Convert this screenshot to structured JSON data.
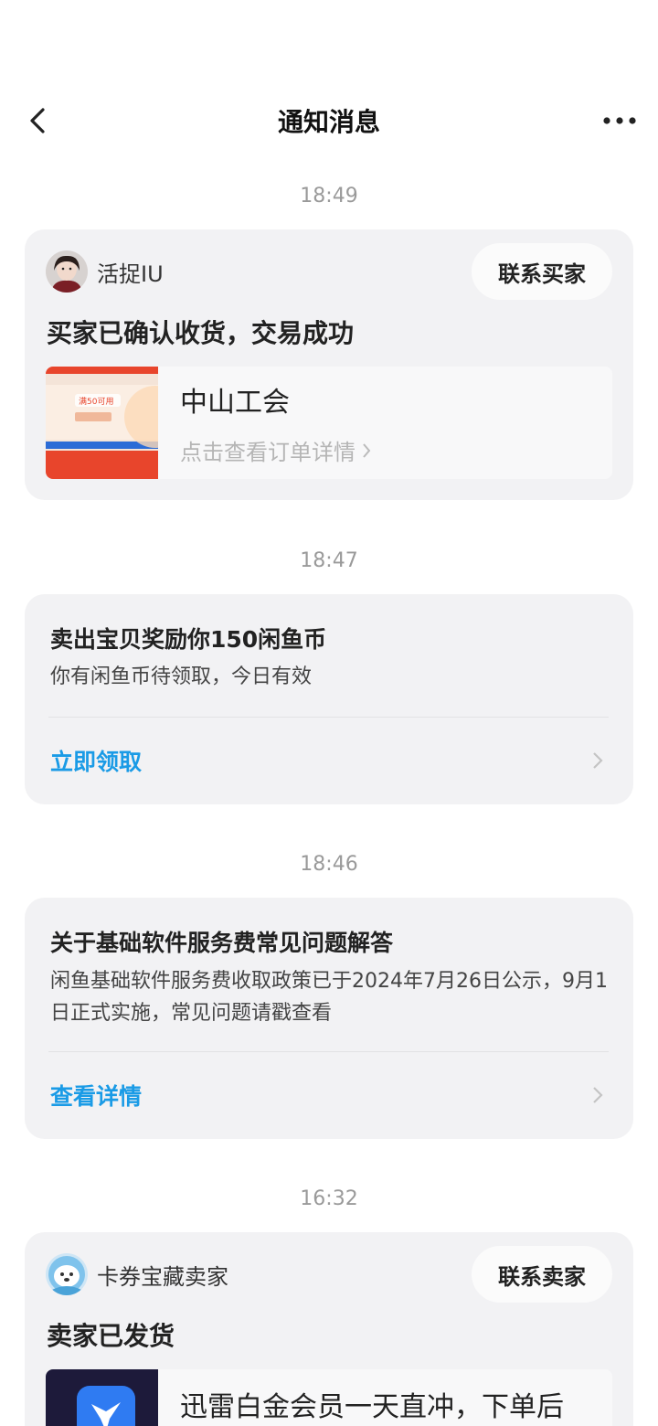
{
  "header": {
    "title": "通知消息"
  },
  "messages": [
    {
      "time": "18:49",
      "user": "活捉IU",
      "contact_label": "联系买家",
      "status": "买家已确认收货，交易成功",
      "product": {
        "name": "中山工会",
        "link": "点击查看订单详情",
        "thumb_text": "满50可用"
      }
    },
    {
      "time": "18:47",
      "title": "卖出宝贝奖励你150闲鱼币",
      "subtitle": "你有闲鱼币待领取，今日有效",
      "action": "立即领取"
    },
    {
      "time": "18:46",
      "title": "关于基础软件服务费常见问题解答",
      "subtitle": "闲鱼基础软件服务费收取政策已于2024年7月26日公示，9月1日正式实施，常见问题请戳查看",
      "action": "查看详情"
    },
    {
      "time": "16:32",
      "user": "卡券宝藏卖家",
      "contact_label": "联系卖家",
      "status": "卖家已发货",
      "product": {
        "name": "迅雷白金会员一天直冲，下单后"
      }
    }
  ],
  "colors": {
    "accent": "#1a9be6",
    "card_bg": "#f2f2f4",
    "time_text": "#9a9a9a"
  }
}
